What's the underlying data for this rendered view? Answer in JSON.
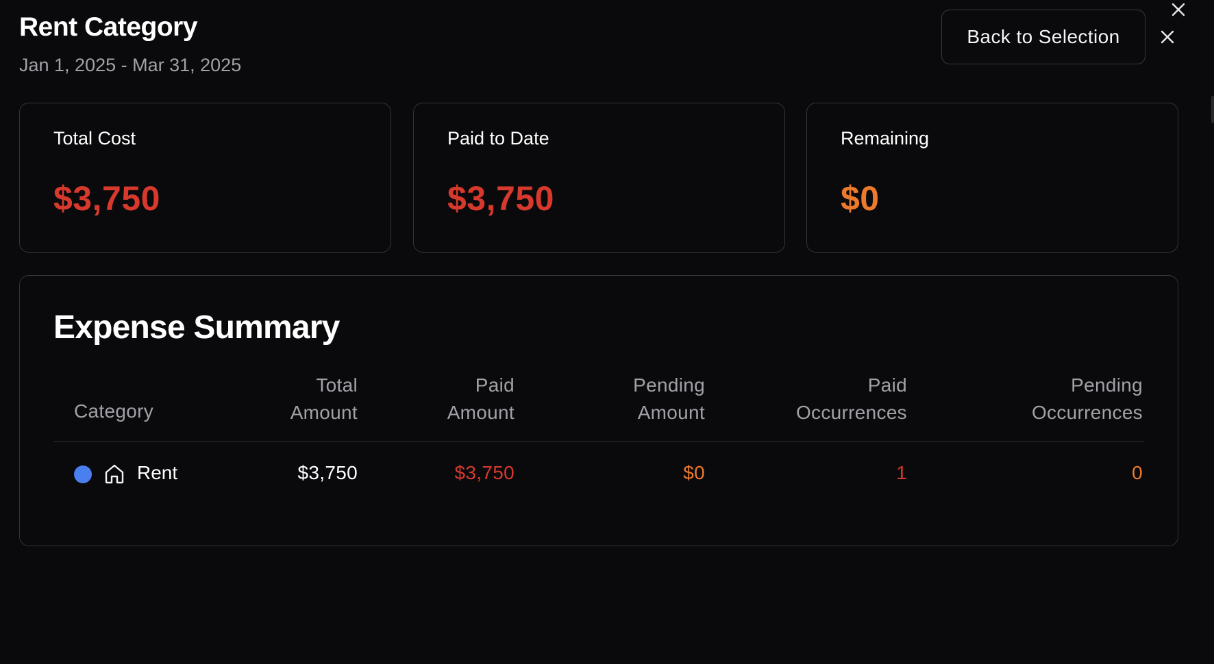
{
  "header": {
    "title": "Rent Category",
    "date_range": "Jan 1, 2025 - Mar 31, 2025",
    "back_button": "Back to Selection"
  },
  "cards": [
    {
      "label": "Total Cost",
      "value": "$3,750",
      "color": "#d7392c"
    },
    {
      "label": "Paid to Date",
      "value": "$3,750",
      "color": "#d7392c"
    },
    {
      "label": "Remaining",
      "value": "$0",
      "color": "#ec7a2c"
    }
  ],
  "summary": {
    "title": "Expense Summary",
    "columns": [
      {
        "line1": "Category",
        "line2": ""
      },
      {
        "line1": "Total",
        "line2": "Amount"
      },
      {
        "line1": "Paid",
        "line2": "Amount"
      },
      {
        "line1": "Pending",
        "line2": "Amount"
      },
      {
        "line1": "Paid",
        "line2": "Occurrences"
      },
      {
        "line1": "Pending",
        "line2": "Occurrences"
      }
    ],
    "rows": [
      {
        "category": "Rent",
        "category_color": "#4a7ff0",
        "category_icon": "home-icon",
        "total_amount": "$3,750",
        "paid_amount": "$3,750",
        "pending_amount": "$0",
        "paid_occurrences": "1",
        "pending_occurrences": "0"
      }
    ]
  },
  "colors": {
    "background": "#0a0a0c",
    "border": "#34343a",
    "paid_red": "#d7392c",
    "pending_orange": "#ec7a2c",
    "muted_text": "#a1a1a8"
  },
  "icons": {
    "outer_close": "close-icon",
    "close": "close-icon",
    "category": "home-icon"
  }
}
